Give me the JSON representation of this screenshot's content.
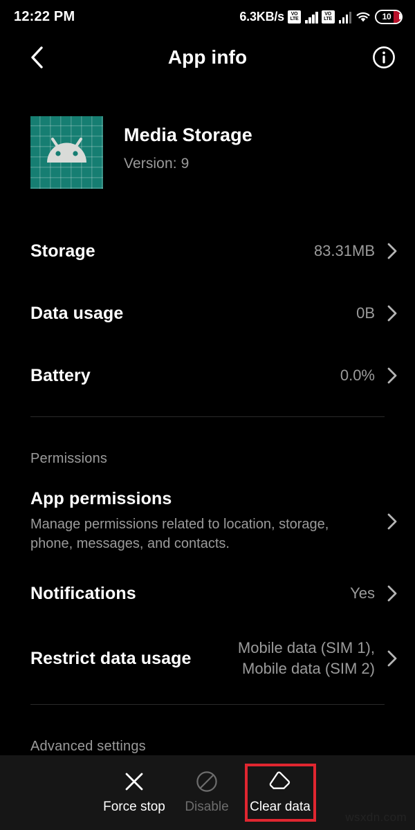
{
  "status_bar": {
    "time": "12:22 PM",
    "network_speed": "6.3KB/s",
    "volte_top": "VO",
    "volte_bottom": "LTE",
    "sim1_icon": "volte-signal-icon",
    "sim2_icon": "volte-signal-icon",
    "wifi_icon": "wifi-icon",
    "battery_level": "10",
    "battery_icon": "battery-icon"
  },
  "app_bar": {
    "back_icon": "chevron-left-icon",
    "title": "App info",
    "info_icon": "info-circle-icon"
  },
  "app_header": {
    "icon_name": "android-media-storage-icon",
    "icon_bg_color": "#167e72",
    "name": "Media Storage",
    "version": "Version: 9"
  },
  "usage_rows": [
    {
      "title": "Storage",
      "value": "83.31MB",
      "chevron": "chevron-right-icon"
    },
    {
      "title": "Data usage",
      "value": "0B",
      "chevron": "chevron-right-icon"
    },
    {
      "title": "Battery",
      "value": "0.0%",
      "chevron": "chevron-right-icon"
    }
  ],
  "permissions_section": {
    "label": "Permissions",
    "app_permissions": {
      "title": "App permissions",
      "subtitle": "Manage permissions related to location, storage, phone, messages, and contacts.",
      "chevron": "chevron-right-icon"
    },
    "notifications": {
      "title": "Notifications",
      "value": "Yes",
      "chevron": "chevron-right-icon"
    },
    "restrict_data_usage": {
      "title": "Restrict data usage",
      "value": "Mobile data (SIM 1),\nMobile data (SIM 2)",
      "chevron": "chevron-right-icon"
    }
  },
  "advanced_section": {
    "label": "Advanced settings"
  },
  "bottom_actions": [
    {
      "label": "Force stop",
      "icon": "close-x-icon",
      "disabled": false,
      "highlighted": false
    },
    {
      "label": "Disable",
      "icon": "prohibition-icon",
      "disabled": true,
      "highlighted": false
    },
    {
      "label": "Clear data",
      "icon": "eraser-icon",
      "disabled": false,
      "highlighted": true
    }
  ],
  "highlight_color": "#e02630",
  "watermark": "wsxdn.com"
}
